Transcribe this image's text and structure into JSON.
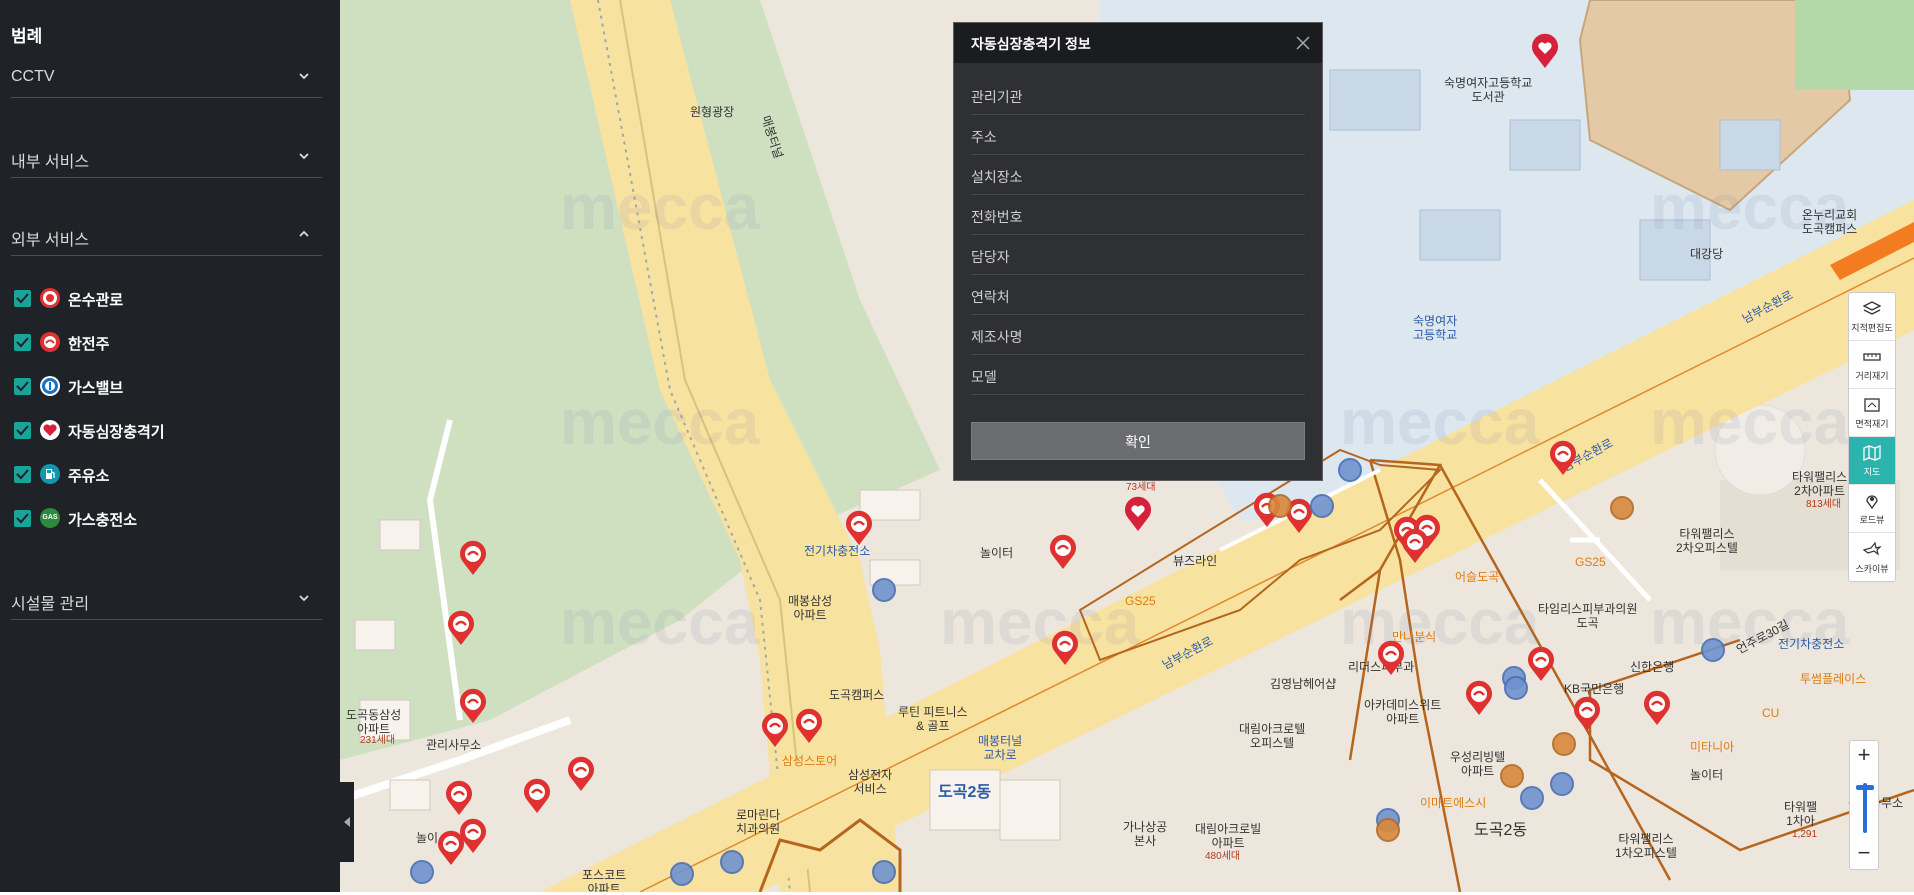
{
  "sidebar": {
    "title": "범례",
    "sections": [
      {
        "label": "CCTV",
        "expanded": false
      },
      {
        "label": "내부 서비스",
        "expanded": false
      },
      {
        "label": "외부 서비스",
        "expanded": true
      },
      {
        "label": "시설물 관리",
        "expanded": false
      }
    ],
    "legend_items": [
      {
        "label": "온수관로",
        "checked": true,
        "icon": "hot-water-pipe-icon",
        "color": "#e03131"
      },
      {
        "label": "한전주",
        "checked": true,
        "icon": "kepco-pole-icon",
        "color": "#e03131"
      },
      {
        "label": "가스밸브",
        "checked": true,
        "icon": "gas-valve-icon",
        "color": "#1971c2"
      },
      {
        "label": "자동심장충격기",
        "checked": true,
        "icon": "aed-heart-icon",
        "color": "#e03131"
      },
      {
        "label": "주유소",
        "checked": true,
        "icon": "gas-station-icon",
        "color": "#1098ad"
      },
      {
        "label": "가스충전소",
        "checked": true,
        "icon": "gas-charging-icon",
        "color": "#2b8a3e",
        "icon_text": "GAS"
      }
    ]
  },
  "modal": {
    "title": "자동심장충격기 정보",
    "fields": [
      {
        "key": "관리기관",
        "value": ""
      },
      {
        "key": "주소",
        "value": ""
      },
      {
        "key": "설치장소",
        "value": ""
      },
      {
        "key": "전화번호",
        "value": ""
      },
      {
        "key": "담당자",
        "value": ""
      },
      {
        "key": "연락처",
        "value": ""
      },
      {
        "key": "제조사명",
        "value": ""
      },
      {
        "key": "모델",
        "value": ""
      }
    ],
    "confirm_label": "확인"
  },
  "toolbar": {
    "buttons": [
      {
        "label": "지적편집도",
        "icon": "layers-icon",
        "active": false
      },
      {
        "label": "거리재기",
        "icon": "ruler-icon",
        "active": false
      },
      {
        "label": "면적재기",
        "icon": "area-icon",
        "active": false
      },
      {
        "label": "지도",
        "icon": "map-icon",
        "active": true
      },
      {
        "label": "로드뷰",
        "icon": "roadview-icon",
        "active": false
      },
      {
        "label": "스카이뷰",
        "icon": "skyview-icon",
        "active": false
      }
    ],
    "zoom_in": "+",
    "zoom_out": "−"
  },
  "map": {
    "watermark": "mecca",
    "labels": {
      "wonhyeong": "원형광장",
      "sukmyung_lib": "숙명여자고등학교\n도서관",
      "sukmyung_hs": "숙명여자\n고등학교",
      "onnuri": "온누리교회\n도곡캠퍼스",
      "daegangdang": "대강당",
      "tower2": "타워팰리스\n2차아파트",
      "tower2_units": "813세대",
      "tower2_office": "타워팰리스\n2차오피스텔",
      "tower1_office": "타워팰리스\n1차오피스텔",
      "tower1": "타워팰\n1차아",
      "tower1_units": "1,291",
      "gwanri_r": "관리사무소",
      "gs25_a": "GS25",
      "gs25_b": "GS25",
      "gs25_c": "GS25",
      "future": "뷰즈라인",
      "ev_a": "전기차충전소",
      "ev_b": "전기차충전소",
      "maebong": "매봉삼성\n아파트",
      "dogok_campus": "도곡캠퍼스",
      "routine": "루틴 피트니스\n& 골프",
      "samsung_store": "삼성스토어",
      "samsung_elec": "삼성전자\n서비스",
      "romarinda": "로마린다\n치과의원",
      "dogok_samsung": "도곡동삼성\n아파트",
      "dogok_samsung_units": "231세대",
      "gwanri_l": "관리사무소",
      "posco": "포스코트\n아파트",
      "maebong_tunnel": "매봉터널\n교차로",
      "dogok2_a": "도곡2동",
      "dogok2_b": "도곡2동",
      "gananpyo": "가나상공\n본사",
      "daerim_village": "대림아크로빌\n아파트",
      "daerim_village_units": "480세대",
      "daerim_tel": "대림아크로텔\n오피스텔",
      "kimyoungnam": "김영남헤어샵",
      "riders": "리더스피부과",
      "academy": "아카데미스위트\n아파트",
      "manna": "만나분식",
      "eoseul": "어슬도곡",
      "time": "타임리스피부과의원\n도곡",
      "kb": "KB국민은행",
      "shinhan": "신한은행",
      "woosung": "우성리빙텔\n아파트",
      "emart": "이마트에스시",
      "tuben": "투썸플레이스",
      "mirror": "미타니아",
      "cu": "CU",
      "noli_a": "놀이터",
      "noli_b": "놀이터",
      "noli_c": "놀이",
      "road_nambu": "남부순환로",
      "road_eonju": "언주로30길",
      "maebong_tunnel_road": "매봉터널",
      "jangsu": "73세대"
    }
  }
}
